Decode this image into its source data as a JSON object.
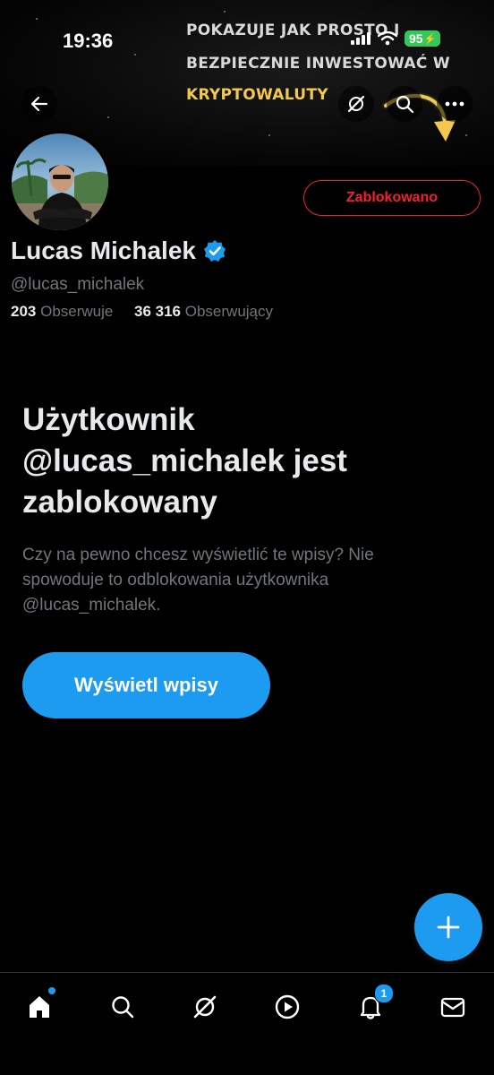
{
  "status_bar": {
    "time": "19:36",
    "battery": "95"
  },
  "banner": {
    "line1": "POKAZUJE JAK PROSTO I",
    "line2": "BEZPIECZNIE INWESTOWAĆ W",
    "line3": "KRYPTOWALUTY"
  },
  "profile": {
    "name": "Lucas Michalek",
    "handle": "@lucas_michalek",
    "following_count": "203",
    "following_label": "Obserwuje",
    "followers_count": "36 316",
    "followers_label": "Obserwujący",
    "blocked_button": "Zablokowano"
  },
  "blocked_notice": {
    "title_line1": "Użytkownik",
    "title_line2": "@lucas_michalek jest",
    "title_line3": "zablokowany",
    "desc_line1": "Czy na pewno chcesz wyświetlić te wpisy? Nie",
    "desc_line2": "spowoduje to odblokowania użytkownika",
    "desc_line3": "@lucas_michalek.",
    "show_button": "Wyświetl wpisy"
  },
  "bottom_nav": {
    "notifications_badge": "1",
    "items": [
      "home-icon",
      "search-icon",
      "grok-icon",
      "video-icon",
      "bell-icon",
      "mail-icon"
    ]
  },
  "colors": {
    "accent": "#1d9bf0",
    "danger": "#f4212e",
    "muted": "#71767b",
    "banner_highlight": "#f2c94c"
  }
}
